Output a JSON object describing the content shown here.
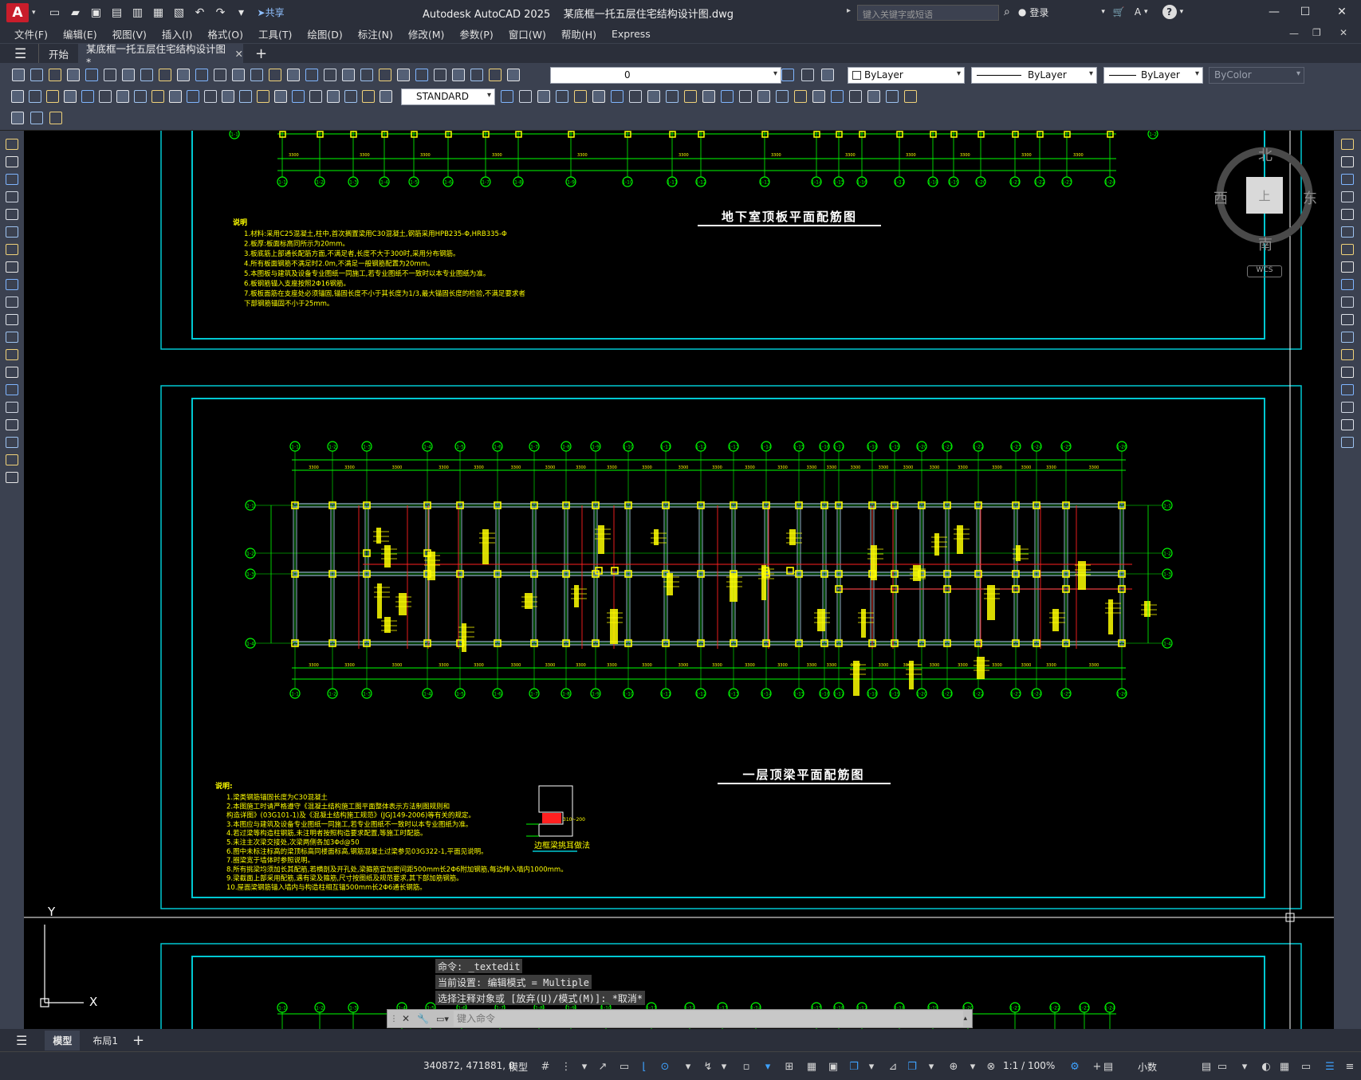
{
  "app": {
    "logo": "A",
    "name": "Autodesk AutoCAD 2025",
    "file": "某底框一托五层住宅结构设计图.dwg"
  },
  "quick_access": {
    "share": "共享"
  },
  "search": {
    "placeholder": "键入关键字或短语"
  },
  "account": {
    "login": "登录"
  },
  "menu": [
    "文件(F)",
    "编辑(E)",
    "视图(V)",
    "插入(I)",
    "格式(O)",
    "工具(T)",
    "绘图(D)",
    "标注(N)",
    "修改(M)",
    "参数(P)",
    "窗口(W)",
    "帮助(H)",
    "Express"
  ],
  "tabs": {
    "start": "开始",
    "doc": "某底框一托五层住宅结构设计图*",
    "new": "+"
  },
  "toolbar": {
    "layer_value": "0",
    "color": "ByLayer",
    "linetype": "ByLayer",
    "lineweight": "ByLayer",
    "plotstyle": "ByColor",
    "text_style": "STANDARD"
  },
  "drawing": {
    "plan_title_top": "地下室顶板平面配筋图",
    "plan_title_mid": "一层顶梁平面配筋图",
    "detail_title": "边框梁挑耳做法",
    "notes_header_top": "说明",
    "notes_top": [
      "1.材料:采用C25混凝土,柱中,首次搁置梁用C30混凝土,钢筋采用HPB235-Φ,HRB335-Φ",
      "2.板厚:板面标高同所示为20mm。",
      "3.板底筋上部通长配筋方面,不满足者,长度不大于300时,采用分布钢筋。",
      "4.所有板面钢筋不满足时2.0m,不满足一般钢筋配置为20mm。",
      "5.本图板与建筑及设备专业图纸一同施工,若专业图纸不一致时以本专业图纸为准。",
      "6.板钢筋锚入支座按照2Φ16钢筋。",
      "7.板板面筋在支座处必须锚固,锚固长度不小于其长度为1/3,最大锚固长度的检验,不满足要求者",
      "  下部钢筋锚固不小于25mm。"
    ],
    "notes_header_mid": "说明:",
    "notes_mid": [
      "1.梁类钢筋锚固长度为C30混凝土",
      "2.本图施工时请严格遵守《混凝土结构施工图平面整体表示方法制图规则和",
      "  构造详图》(03G101-1)及《混凝土结构施工规范》(JGJ149-2006)等有关的规定。",
      "3.本图应与建筑及设备专业图纸一同施工,若专业图纸不一致时以本专业图纸为准。",
      "4.若过梁等构造柱钢筋,未注明者按照构造要求配置,等施工时配筋。",
      "5.未注主次梁交接处,次梁两侧各加3Φd@50",
      "6.图中未标注标高的梁顶标高同楼面标高,钢筋混凝土过梁参见03G322-1,平面见说明。",
      "7.圈梁宽于墙体时参照说明。",
      "8.所有挑梁均须加长其配筋,若横剖及开孔处,梁箍筋宜加密间距500mm长2Φ6附加钢筋,每边伸入墙内1000mm。",
      "9.梁截面上部采用配筋,遇有梁及箍筋,尺寸按图纸及规范要求,其下部加筋钢筋。",
      "10.屋面梁钢筋锚入墙内与构造柱相互锚500mm长2Φ6通长钢筋。"
    ]
  },
  "axis_labels": [
    "1-1",
    "1-2",
    "1-3",
    "1-4",
    "1-5",
    "1-6",
    "1-7",
    "1-8",
    "1-9",
    "1-10",
    "1-11",
    "1-12",
    "1-13",
    "1-14",
    "1-15",
    "1-16",
    "1-17",
    "1-18",
    "1-19",
    "1-20",
    "1-21",
    "1-22",
    "1-23",
    "1-24",
    "1-25",
    "1-26"
  ],
  "viewcube": {
    "north": "北",
    "south": "南",
    "west": "西",
    "east": "东",
    "top": "上",
    "wcs": "WCS"
  },
  "ucs": {
    "x": "X",
    "y": "Y"
  },
  "command": {
    "history": [
      "命令: _textedit",
      "当前设置: 编辑模式 = Multiple",
      "选择注释对象或 [放弃(U)/模式(M)]: *取消*"
    ],
    "placeholder": "键入命令"
  },
  "layouts": {
    "model": "模型",
    "layout1": "布局1",
    "add": "+"
  },
  "status": {
    "coords": "340872, 471881, 0",
    "space": "模型",
    "scale": "1:1 / 100%",
    "units": "小数"
  },
  "colors": {
    "frame": "#00c8d2",
    "grid": "#00ff00",
    "column": "#ffff00",
    "axis_red": "#ff2020",
    "text_yellow": "#ffff00",
    "dim_green": "#00ff00",
    "accent": "#3ea2ff"
  }
}
